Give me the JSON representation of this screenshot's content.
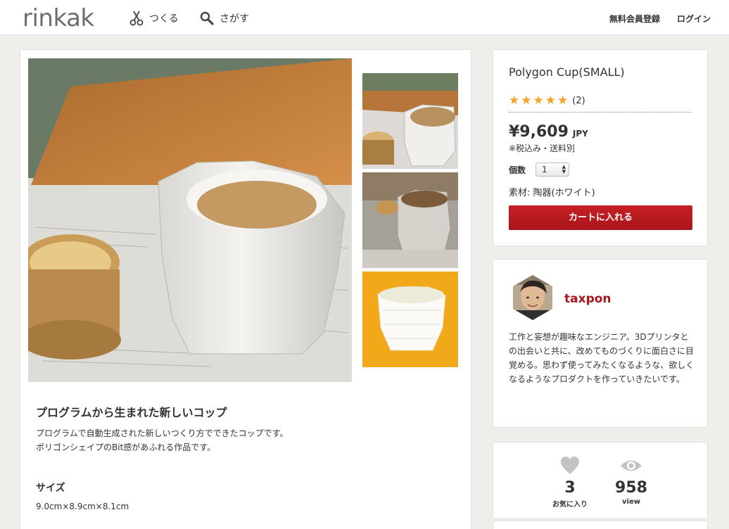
{
  "header": {
    "logo": "rinkak",
    "nav": {
      "make": "つくる",
      "find": "さがす"
    },
    "signup": "無料会員登録",
    "login": "ログイン"
  },
  "product": {
    "name": "Polygon Cup(SMALL)",
    "rating_stars": 5,
    "rating_count": "(2)",
    "price": "¥9,609",
    "currency": "JPY",
    "tax_note": "※税込み・送料別",
    "qty_label": "個数",
    "qty_value": "1",
    "material": "素材: 陶器(ホワイト)",
    "cart_button": "カートに入れる"
  },
  "description": {
    "title": "プログラムから生まれた新しいコップ",
    "line1": "プログラムで自動生成された新しいつくり方でできたコップです。",
    "line2": "ポリゴンシェイプのBit感があふれる作品です。",
    "size_title": "サイズ",
    "size_value": "9.0cm×8.9cm×8.1cm"
  },
  "creator": {
    "name": "taxpon",
    "bio": "工作と妄想が趣味なエンジニア。3Dプリンタとの出会いと共に、改めてものづくりに面白さに目覚める。思わず使ってみたくなるような、欲しくなるようなプロダクトを作っていきたいです。"
  },
  "stats": {
    "favorites": "3",
    "favorites_label": "お気に入り",
    "views": "958",
    "views_label": "view"
  },
  "colors": {
    "accent_red": "#a8161c",
    "star": "#f2a324",
    "background": "#efeeeb"
  }
}
